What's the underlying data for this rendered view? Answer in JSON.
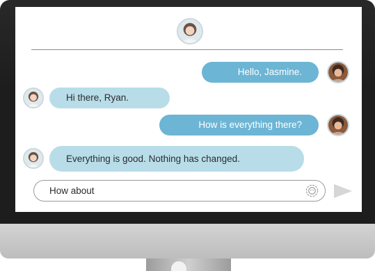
{
  "header": {
    "contact_avatar_icon": "avatar-jasmine-icon"
  },
  "messages": [
    {
      "side": "outgoing",
      "sender": "Ryan",
      "text": "Hello, Jasmine."
    },
    {
      "side": "incoming",
      "sender": "Jasmine",
      "text": "Hi there, Ryan."
    },
    {
      "side": "outgoing",
      "sender": "Ryan",
      "text": "How is everything there?"
    },
    {
      "side": "incoming",
      "sender": "Jasmine",
      "text": "Everything is good. Nothing has changed."
    }
  ],
  "composer": {
    "value": "How about",
    "emoji_icon": "emoji-icon",
    "send_icon": "send-icon"
  },
  "colors": {
    "outgoing_bubble": "#6cb5d4",
    "incoming_bubble": "#b8dde9",
    "send_icon": "#d6d6d6",
    "bezel": "#1d1d1d",
    "chin": "#c8c8c8"
  }
}
